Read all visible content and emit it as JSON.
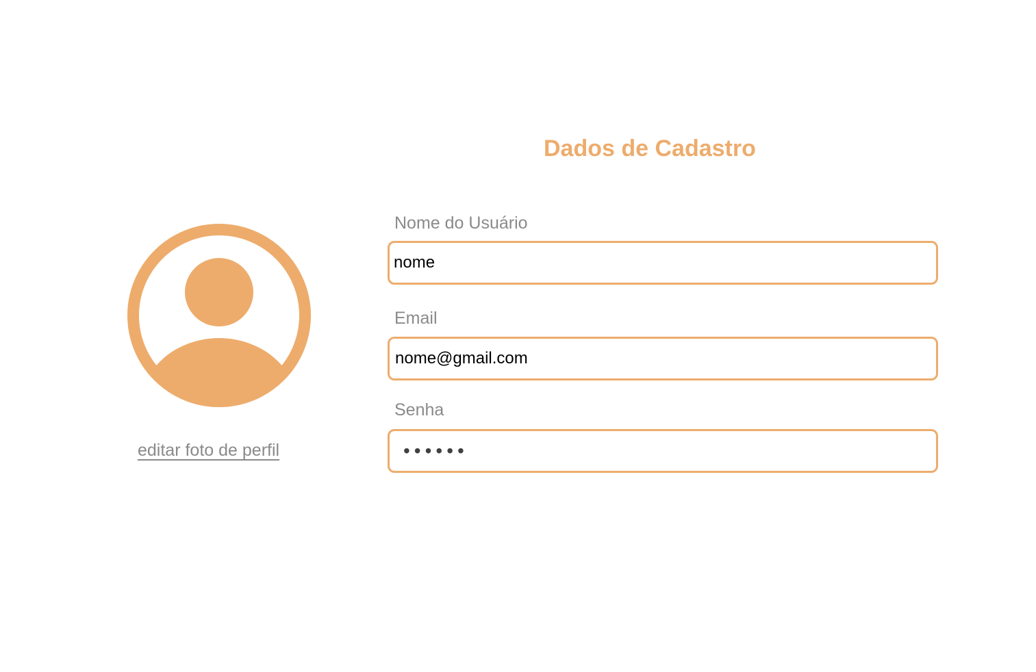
{
  "form": {
    "title": "Dados de Cadastro",
    "fields": {
      "username": {
        "label": "Nome do Usuário",
        "value": "nome"
      },
      "email": {
        "label": "Email",
        "value": "nome@gmail.com"
      },
      "password": {
        "label": "Senha",
        "value": "senha1"
      }
    }
  },
  "profile": {
    "avatar_icon": "user-avatar-icon",
    "edit_photo_label": "editar foto de perfil"
  },
  "colors": {
    "accent": "#EDAC6C",
    "label_gray": "#8A8A8A",
    "mask_dots": "#404040"
  }
}
